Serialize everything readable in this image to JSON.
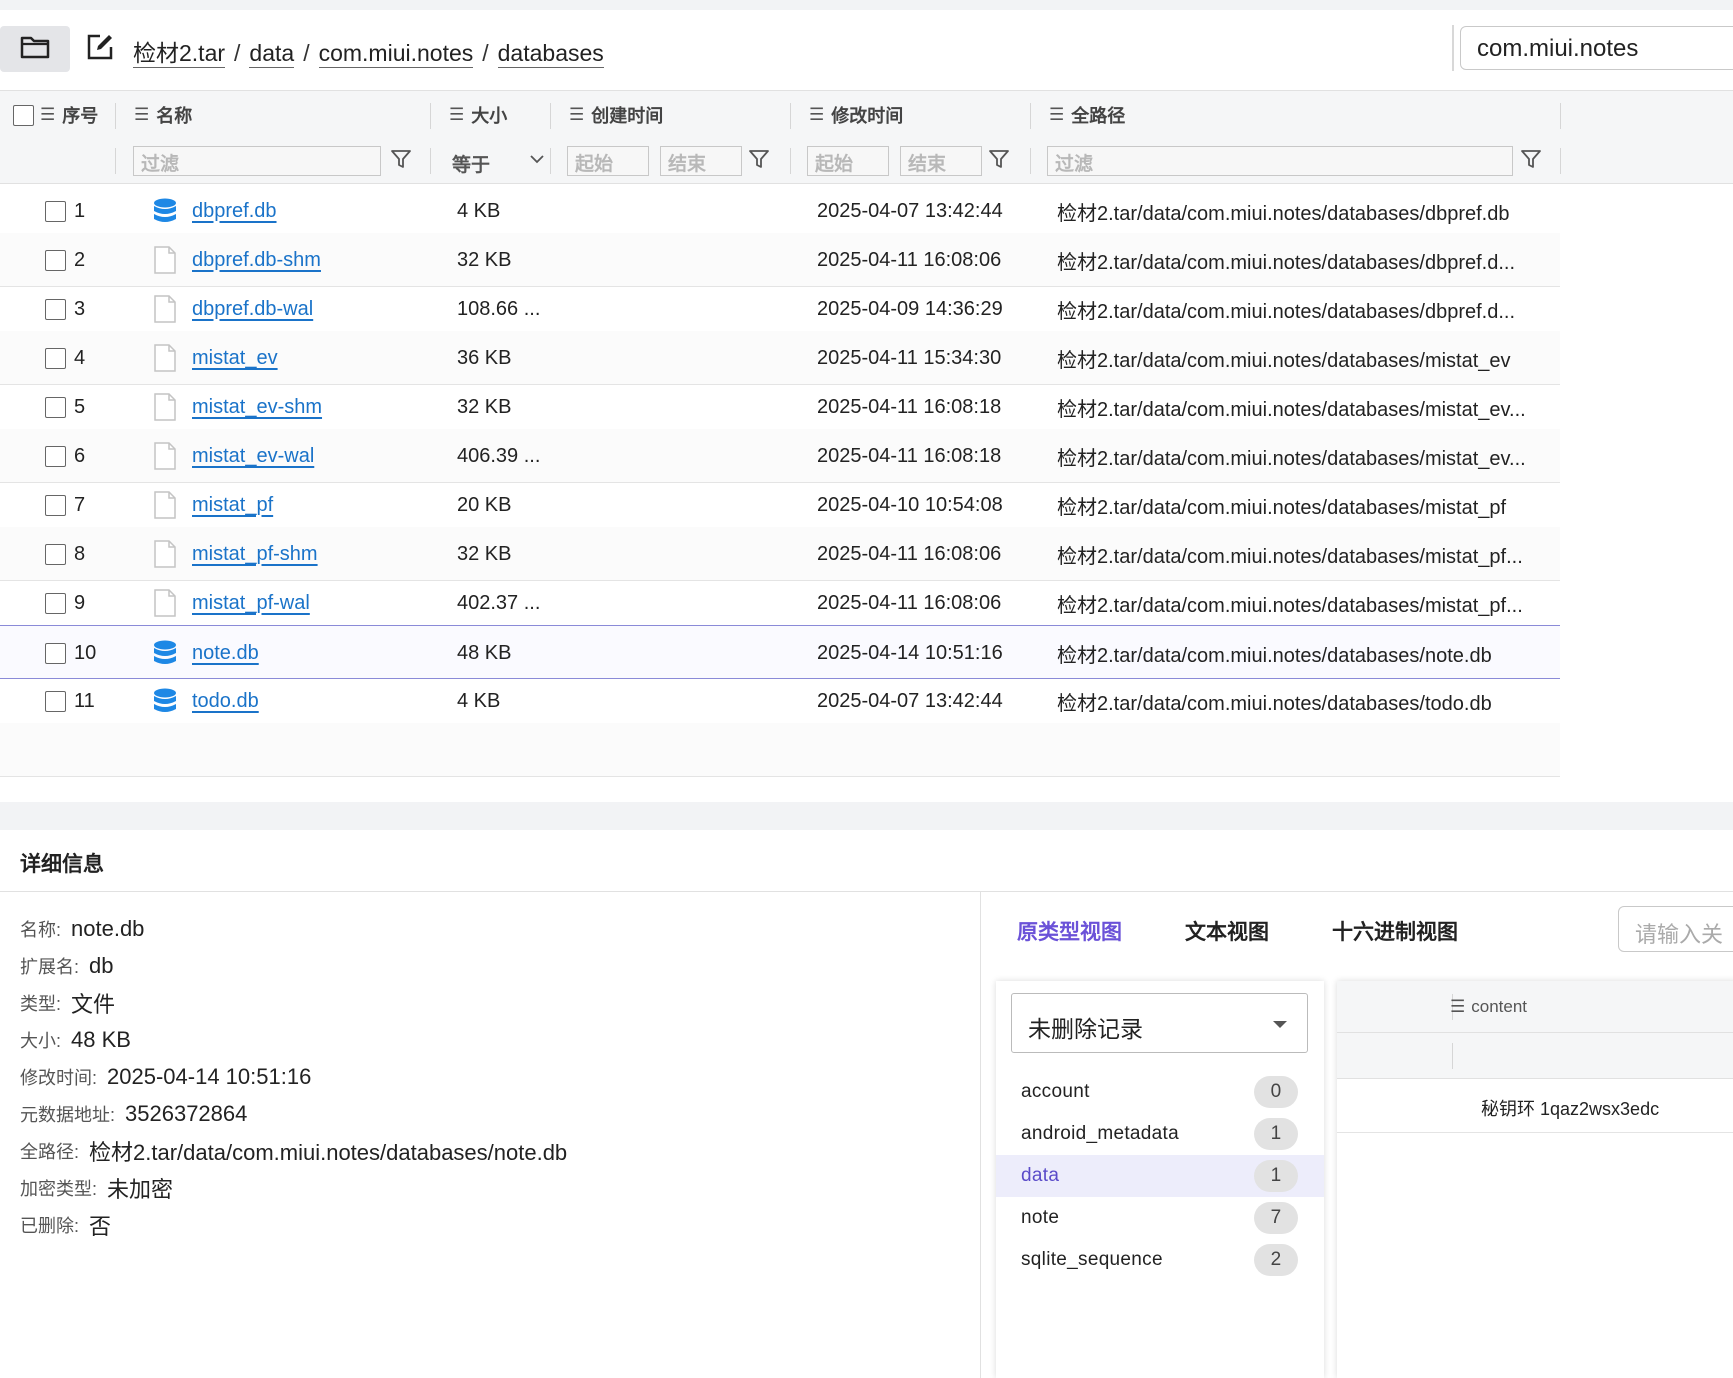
{
  "toolbar": {
    "breadcrumb": [
      "检材2.tar",
      "data",
      "com.miui.notes",
      "databases"
    ],
    "breadcrumb_sep": "/",
    "path_value": "com.miui.notes"
  },
  "table": {
    "columns": {
      "index": "序号",
      "name": "名称",
      "size": "大小",
      "created": "创建时间",
      "modified": "修改时间",
      "fullpath": "全路径"
    },
    "filters": {
      "name_placeholder": "过滤",
      "size_op": "等于",
      "created_start": "起始",
      "created_end": "结束",
      "modified_start": "起始",
      "modified_end": "结束",
      "path_placeholder": "过滤"
    },
    "rows": [
      {
        "index": "1",
        "name": "dbpref.db",
        "icon": "database-icon",
        "size": "4 KB",
        "modified": "2025-04-07 13:42:44",
        "path": "检材2.tar/data/com.miui.notes/databases/dbpref.db"
      },
      {
        "index": "2",
        "name": "dbpref.db-shm",
        "icon": "file-icon",
        "size": "32 KB",
        "modified": "2025-04-11 16:08:06",
        "path": "检材2.tar/data/com.miui.notes/databases/dbpref.d..."
      },
      {
        "index": "3",
        "name": "dbpref.db-wal",
        "icon": "file-icon",
        "size": "108.66 ...",
        "modified": "2025-04-09 14:36:29",
        "path": "检材2.tar/data/com.miui.notes/databases/dbpref.d..."
      },
      {
        "index": "4",
        "name": "mistat_ev",
        "icon": "file-icon",
        "size": "36 KB",
        "modified": "2025-04-11 15:34:30",
        "path": "检材2.tar/data/com.miui.notes/databases/mistat_ev"
      },
      {
        "index": "5",
        "name": "mistat_ev-shm",
        "icon": "file-icon",
        "size": "32 KB",
        "modified": "2025-04-11 16:08:18",
        "path": "检材2.tar/data/com.miui.notes/databases/mistat_ev..."
      },
      {
        "index": "6",
        "name": "mistat_ev-wal",
        "icon": "file-icon",
        "size": "406.39 ...",
        "modified": "2025-04-11 16:08:18",
        "path": "检材2.tar/data/com.miui.notes/databases/mistat_ev..."
      },
      {
        "index": "7",
        "name": "mistat_pf",
        "icon": "file-icon",
        "size": "20 KB",
        "modified": "2025-04-10 10:54:08",
        "path": "检材2.tar/data/com.miui.notes/databases/mistat_pf"
      },
      {
        "index": "8",
        "name": "mistat_pf-shm",
        "icon": "file-icon",
        "size": "32 KB",
        "modified": "2025-04-11 16:08:06",
        "path": "检材2.tar/data/com.miui.notes/databases/mistat_pf..."
      },
      {
        "index": "9",
        "name": "mistat_pf-wal",
        "icon": "file-icon",
        "size": "402.37 ...",
        "modified": "2025-04-11 16:08:06",
        "path": "检材2.tar/data/com.miui.notes/databases/mistat_pf..."
      },
      {
        "index": "10",
        "name": "note.db",
        "icon": "database-icon",
        "size": "48 KB",
        "modified": "2025-04-14 10:51:16",
        "path": "检材2.tar/data/com.miui.notes/databases/note.db"
      },
      {
        "index": "11",
        "name": "todo.db",
        "icon": "database-icon",
        "size": "4 KB",
        "modified": "2025-04-07 13:42:44",
        "path": "检材2.tar/data/com.miui.notes/databases/todo.db"
      }
    ],
    "selected_index": "10"
  },
  "details": {
    "title": "详细信息",
    "items": [
      {
        "key": "名称:",
        "value": "note.db"
      },
      {
        "key": "扩展名:",
        "value": "db"
      },
      {
        "key": "类型:",
        "value": "文件"
      },
      {
        "key": "大小:",
        "value": "48 KB"
      },
      {
        "key": "修改时间:",
        "value": "2025-04-14 10:51:16"
      },
      {
        "key": "元数据地址:",
        "value": "3526372864"
      },
      {
        "key": "全路径:",
        "value": "检材2.tar/data/com.miui.notes/databases/note.db"
      },
      {
        "key": "加密类型:",
        "value": "未加密"
      },
      {
        "key": "已删除:",
        "value": "否"
      }
    ]
  },
  "viewer": {
    "tabs": [
      "原类型视图",
      "文本视图",
      "十六进制视图"
    ],
    "active_tab": "原类型视图",
    "keyword_placeholder": "请输入关",
    "record_filter": "未删除记录",
    "tables": [
      {
        "name": "account",
        "count": "0"
      },
      {
        "name": "android_metadata",
        "count": "1"
      },
      {
        "name": "data",
        "count": "1"
      },
      {
        "name": "note",
        "count": "7"
      },
      {
        "name": "sqlite_sequence",
        "count": "2"
      }
    ],
    "selected_table": "data",
    "result": {
      "column": "content",
      "rows": [
        "秘钥环 1qaz2wsx3edc"
      ]
    }
  },
  "colors": {
    "link": "#1a73c9",
    "accent": "#6b52d8",
    "db_icon": "#1e88e5"
  }
}
